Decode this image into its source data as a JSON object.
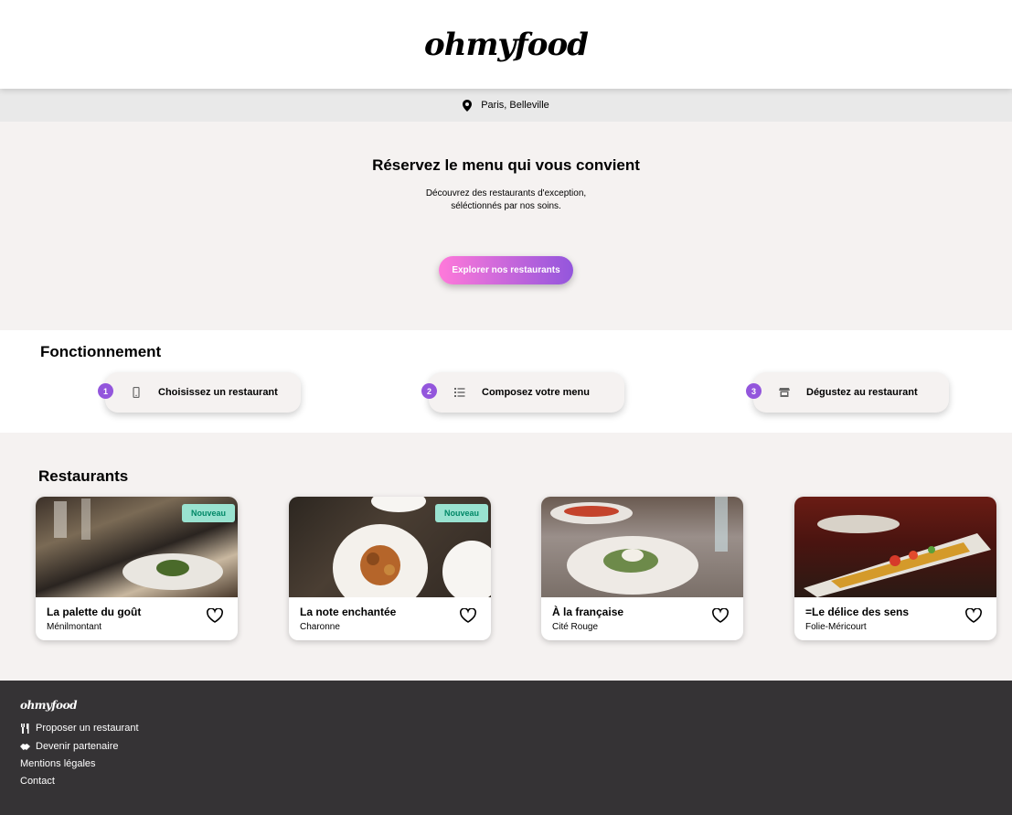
{
  "header": {
    "logo": "ohmyfood"
  },
  "location": {
    "text": "Paris, Belleville",
    "icon": "map-pin-icon"
  },
  "hero": {
    "title": "Réservez le menu qui vous convient",
    "subtitle_line1": "Découvrez des restaurants d'exception,",
    "subtitle_line2": "séléctionnés par nos soins.",
    "cta_label": "Explorer nos restaurants"
  },
  "how_it_works": {
    "title": "Fonctionnement",
    "steps": [
      {
        "number": "1",
        "label": "Choisissez un restaurant",
        "icon": "mobile-phone-icon"
      },
      {
        "number": "2",
        "label": "Composez votre menu",
        "icon": "list-icon"
      },
      {
        "number": "3",
        "label": "Dégustez au restaurant",
        "icon": "store-icon"
      }
    ]
  },
  "restaurants": {
    "title": "Restaurants",
    "items": [
      {
        "name": "La palette du goût",
        "area": "Ménilmontant",
        "badge": "Nouveau"
      },
      {
        "name": "La note enchantée",
        "area": "Charonne",
        "badge": "Nouveau"
      },
      {
        "name": "À la française",
        "area": "Cité Rouge",
        "badge": ""
      },
      {
        "name": "=Le délice des sens",
        "area": "Folie-Méricourt",
        "badge": ""
      }
    ]
  },
  "footer": {
    "logo": "ohmyfood",
    "links": [
      {
        "label": "Proposer un restaurant",
        "icon": "utensils-icon"
      },
      {
        "label": "Devenir partenaire",
        "icon": "handshake-icon"
      },
      {
        "label": "Mentions légales",
        "icon": ""
      },
      {
        "label": "Contact",
        "icon": ""
      }
    ]
  },
  "colors": {
    "accent_pink": "#ff79da",
    "accent_purple": "#9356dc",
    "badge_bg": "#99e2d0",
    "badge_text": "#008766",
    "footer_bg": "#353335"
  }
}
